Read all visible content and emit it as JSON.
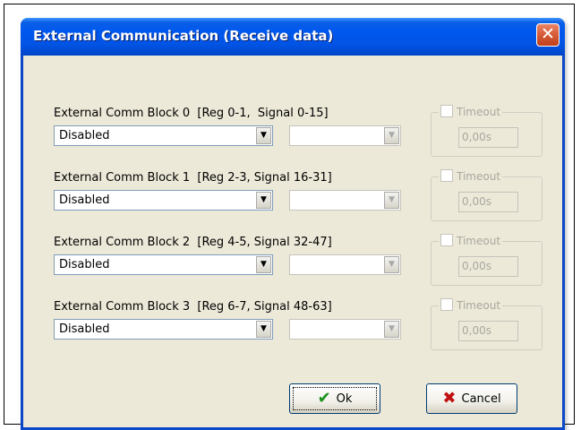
{
  "window": {
    "title": "External Communication (Receive data)",
    "close_glyph": "✕"
  },
  "blocks": [
    {
      "label": "External Comm Block 0  [Reg 0-1,  Signal 0-15]",
      "mode": "Disabled",
      "timeout_label": "Timeout",
      "timeout_value": "0,00s"
    },
    {
      "label": "External Comm Block 1  [Reg 2-3, Signal 16-31]",
      "mode": "Disabled",
      "timeout_label": "Timeout",
      "timeout_value": "0,00s"
    },
    {
      "label": "External Comm Block 2  [Reg 4-5, Signal 32-47]",
      "mode": "Disabled",
      "timeout_label": "Timeout",
      "timeout_value": "0,00s"
    },
    {
      "label": "External Comm Block 3  [Reg 6-7, Signal 48-63]",
      "mode": "Disabled",
      "timeout_label": "Timeout",
      "timeout_value": "0,00s"
    }
  ],
  "buttons": {
    "ok_label": "Ok",
    "cancel_label": "Cancel"
  },
  "icons": {
    "ok": "checkmark-icon",
    "cancel": "x-icon",
    "dropdown": "chevron-down-icon"
  },
  "colors": {
    "titlebar": "#0058ee",
    "dialog_bg": "#ece9d8",
    "close_button": "#d95d3a"
  }
}
